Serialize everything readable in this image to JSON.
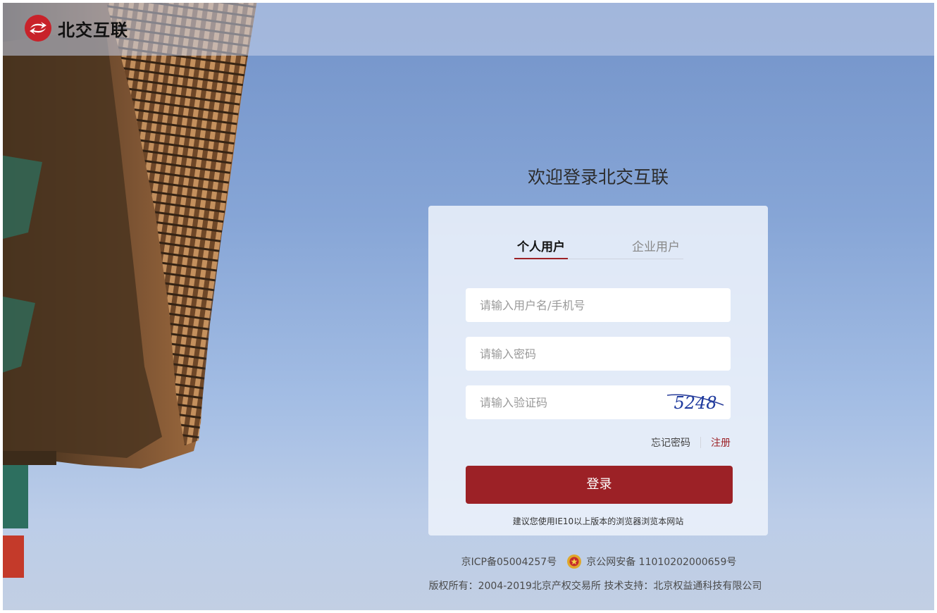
{
  "header": {
    "logo_text": "北交互联"
  },
  "login": {
    "welcome": "欢迎登录北交互联",
    "tabs": [
      {
        "label": "个人用户",
        "active": true
      },
      {
        "label": "企业用户",
        "active": false
      }
    ],
    "username_placeholder": "请输入用户名/手机号",
    "password_placeholder": "请输入密码",
    "captcha_placeholder": "请输入验证码",
    "captcha_text": "5248",
    "forgot_password": "忘记密码",
    "register": "注册",
    "login_button": "登录",
    "browser_hint": "建议您使用IE10以上版本的浏览器浏览本网站"
  },
  "footer": {
    "icp": "京ICP备05004257号",
    "police": "京公网安备 11010202000659号",
    "copyright": "版权所有：2004-2019北京产权交易所   技术支持：北京权益通科技有限公司"
  },
  "colors": {
    "brand_red": "#9c2126",
    "sky": "#86a5d6"
  }
}
